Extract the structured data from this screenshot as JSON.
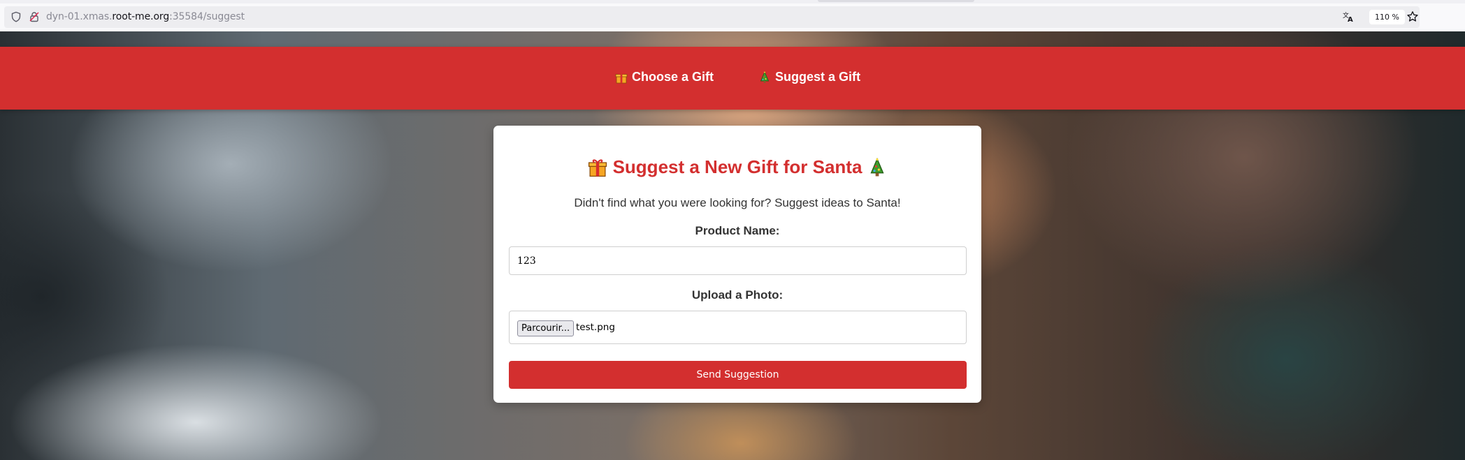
{
  "browser": {
    "url_prefix": "dyn-01.xmas.",
    "url_domain": "root-me.org",
    "url_suffix": ":35584/suggest",
    "zoom": "110 %"
  },
  "nav": {
    "choose_label": "Choose a Gift",
    "suggest_label": "Suggest a Gift"
  },
  "card": {
    "title": "Suggest a New Gift for Santa",
    "subtitle": "Didn't find what you were looking for? Suggest ideas to Santa!",
    "product_label": "Product Name:",
    "product_value": "123",
    "photo_label": "Upload a Photo:",
    "file_button": "Parcourir...",
    "file_name": "test.png",
    "submit_label": "Send Suggestion"
  },
  "icons": {
    "nav_choose": "gift-icon",
    "nav_suggest": "christmas-tree-icon",
    "title_left": "gift-icon",
    "title_right": "christmas-tree-icon"
  },
  "colors": {
    "brand_red": "#d32f2f",
    "card_bg": "#ffffff",
    "text": "#333333"
  }
}
